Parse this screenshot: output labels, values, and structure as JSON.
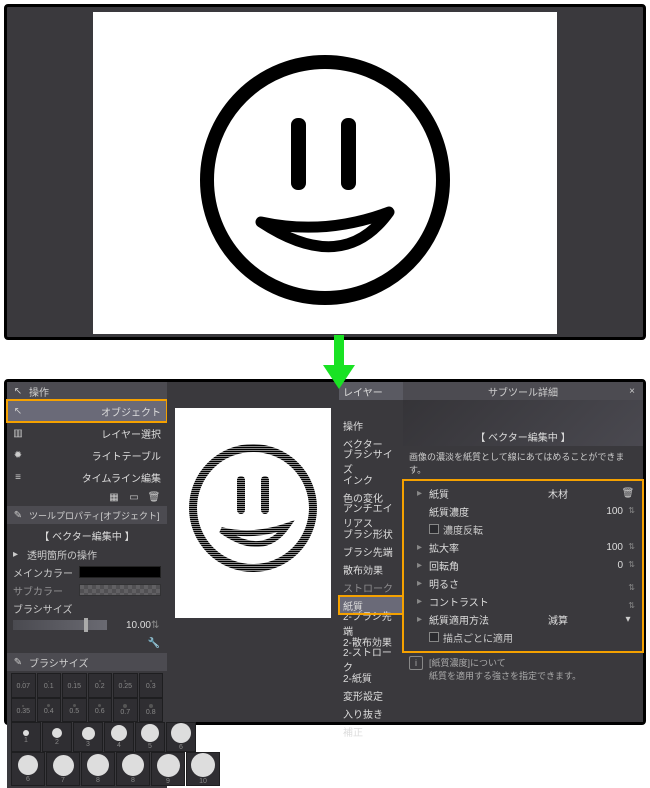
{
  "top": {
    "canvas_art": "smiley-face"
  },
  "arrow_color": "#19e223",
  "left": {
    "panel_header": "操作",
    "tools": [
      {
        "label": "オブジェクト",
        "icon": "cursor",
        "selected": true,
        "highlighted": true
      },
      {
        "label": "レイヤー選択",
        "icon": "layers",
        "selected": false
      },
      {
        "label": "ライトテーブル",
        "icon": "bulb",
        "selected": false
      },
      {
        "label": "タイムライン編集",
        "icon": "timeline",
        "selected": false
      }
    ],
    "toolprop_header": "ツールプロパティ[オブジェクト]",
    "vector_section": "【 ベクター編集中 】",
    "transparent_op": "透明箇所の操作",
    "main_color_label": "メインカラー",
    "sub_color_label": "サブカラー",
    "brush_size_label": "ブラシサイズ",
    "brush_size_value": "10.00",
    "brush_pal_header": "ブラシサイズ",
    "sizes_row1": [
      "0.07",
      "0.1",
      "0.15",
      "0.2",
      "0.25",
      "0.3"
    ],
    "sizes_row2": [
      "0.35",
      "0.4",
      "0.5",
      "0.6",
      "0.7",
      "0.8"
    ],
    "sizes_row3": [
      "1",
      "2",
      "3",
      "4",
      "5",
      "6"
    ],
    "sizes_row4": [
      "6",
      "7",
      "8",
      "8",
      "9",
      "10"
    ]
  },
  "layer_tab": "レイヤー",
  "cats": [
    "操作",
    "ベクター",
    "ブラシサイズ",
    "インク",
    "色の変化",
    "アンチエイリアス",
    "ブラシ形状",
    "ブラシ先端",
    "散布効果",
    "ストローク",
    "紙質",
    "2-ブラシ先端",
    "2-散布効果",
    "2-ストローク",
    "2-紙質",
    "変形設定",
    "入り抜き",
    "補正"
  ],
  "cat_selected_index": 10,
  "detail": {
    "header": "サブツール詳細",
    "banner_title": "【 ベクター編集中 】",
    "desc": "画像の濃淡を紙質として線にあてはめることができます。",
    "rows": {
      "texture_label": "紙質",
      "texture_value": "木材",
      "density_label": "紙質濃度",
      "density_value": "100",
      "invert_label": "濃度反転",
      "scale_label": "拡大率",
      "scale_value": "100",
      "rotation_label": "回転角",
      "rotation_value": "0",
      "brightness_label": "明るさ",
      "brightness_value": "",
      "contrast_label": "コントラスト",
      "contrast_value": "",
      "apply_label": "紙質適用方法",
      "apply_value": "減算",
      "perpoint_label": "描点ごとに適用"
    },
    "info_title": "[紙質濃度]について",
    "info_body": "紙質を適用する強さを指定できます。"
  }
}
